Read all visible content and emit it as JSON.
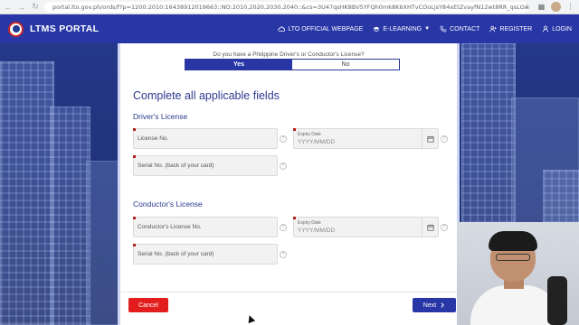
{
  "browser": {
    "url": "portal.lto.gov.ph/ords/f?p=1200:2010:16438912019663::NO:2010,2020,2030,2040::&cs=3U47qsHK8BV5YFQh0mk8K6XHTvCOoLjsY84xEtZvayfN12wt8RR_qsLGw49..."
  },
  "nav": {
    "brand": "LTMS PORTAL",
    "links": {
      "official": "LTO OFFICIAL WEBPAGE",
      "elearning": "E-LEARNING",
      "contact": "CONTACT",
      "register": "REGISTER",
      "login": "LOGIN"
    }
  },
  "form": {
    "question": "Do you have a Philippine Driver's or Conductor's License?",
    "yes_label": "Yes",
    "no_label": "No",
    "selected": "Yes",
    "heading": "Complete all applicable fields",
    "drivers_section": "Driver's License",
    "conductors_section": "Conductor's License",
    "drivers": {
      "license_no_placeholder": "License No.",
      "expiry_caption": "Expiry Date",
      "expiry_placeholder": "YYYY/MM/DD",
      "serial_placeholder": "Serial No. (back of your card)"
    },
    "conductors": {
      "license_no_placeholder": "Conductor's License No.",
      "expiry_caption": "Expiry Date",
      "expiry_placeholder": "YYYY/MM/DD",
      "serial_placeholder": "Serial No. (back of your card)"
    },
    "help_glyph": "?",
    "cancel_label": "Cancel",
    "next_label": "Next"
  },
  "colors": {
    "primary": "#2836a6",
    "cancel": "#e31d1d",
    "heading": "#2c3a8f"
  },
  "icons": [
    "lock-icon",
    "cloud-icon",
    "graduation-icon",
    "phone-icon",
    "user-plus-icon",
    "user-icon",
    "calendar-icon",
    "help-icon",
    "chevron-right-icon"
  ]
}
